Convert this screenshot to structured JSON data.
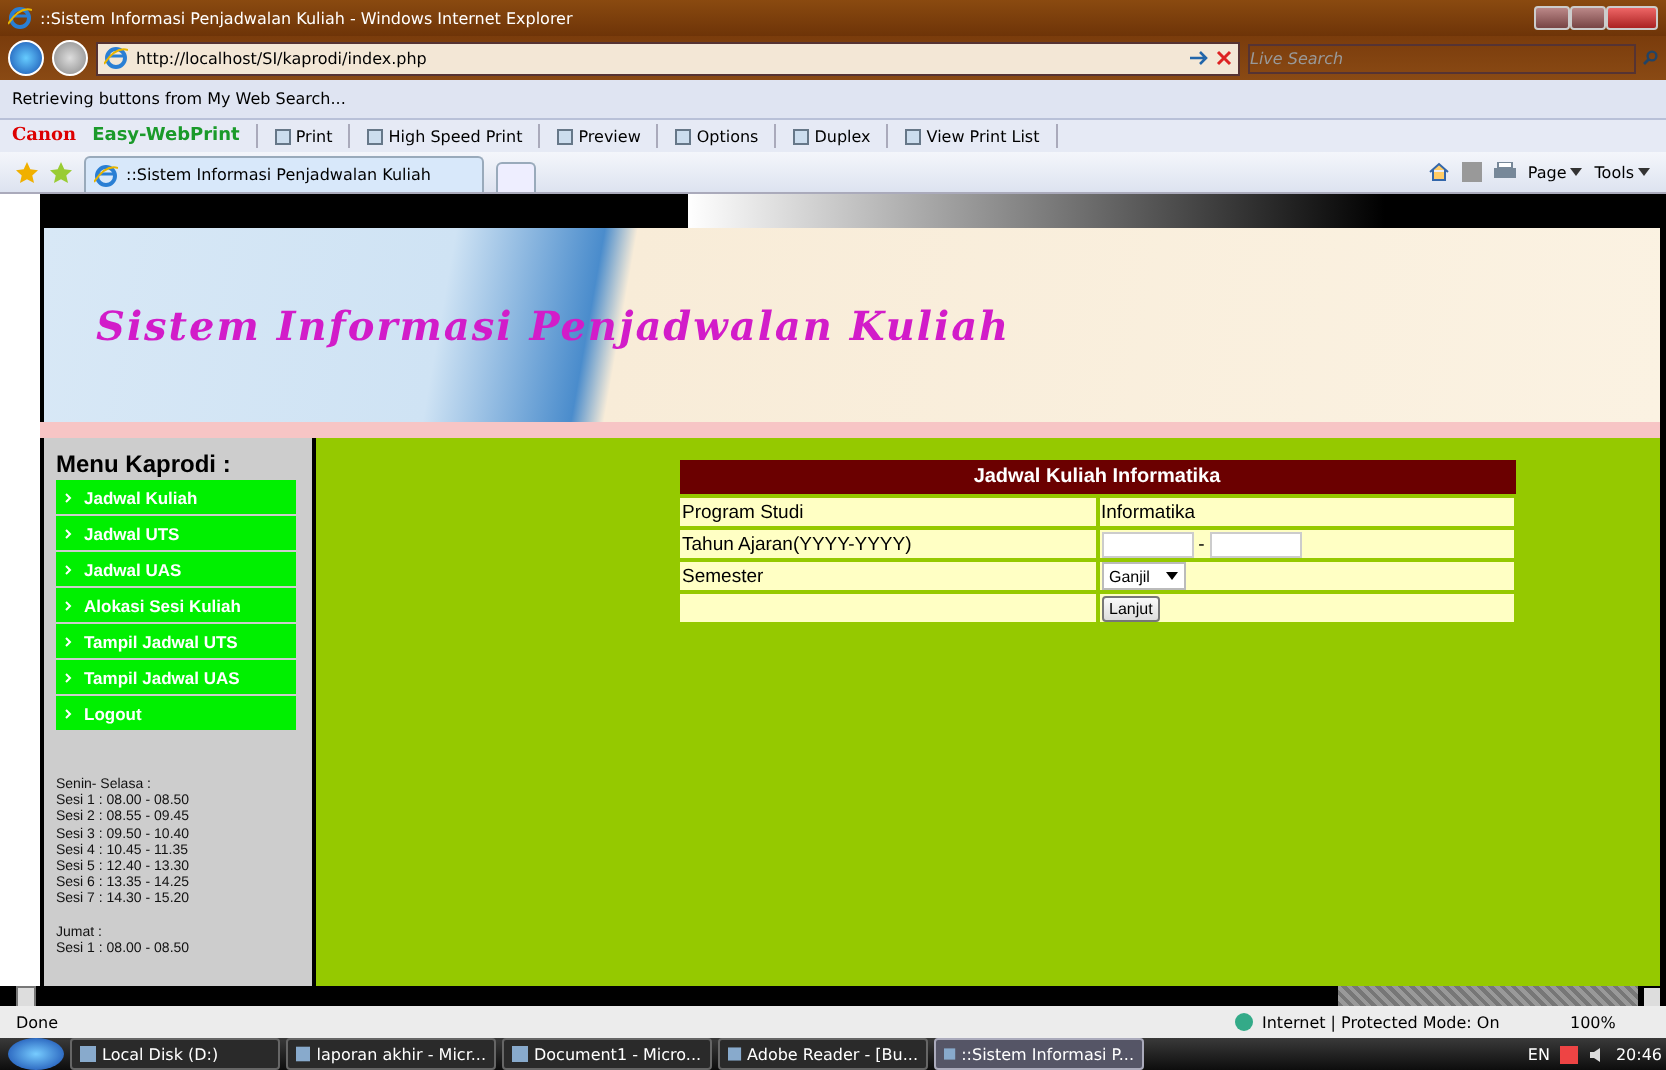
{
  "window": {
    "title": "::Sistem Informasi Penjadwalan Kuliah - Windows Internet Explorer"
  },
  "address_bar": {
    "url": "http://localhost/SI/kaprodi/index.php"
  },
  "search": {
    "placeholder": "Live Search"
  },
  "info_bar": {
    "text": "Retrieving buttons from My Web Search..."
  },
  "print_toolbar": {
    "brand": "Canon",
    "product": "Easy-WebPrint",
    "buttons": [
      "Print",
      "High Speed Print",
      "Preview",
      "Options",
      "Duplex",
      "View Print List"
    ]
  },
  "tabs": [
    {
      "label": "::Sistem Informasi Penjadwalan Kuliah",
      "selected": true
    }
  ],
  "command_bar": [
    "Page",
    "Tools"
  ],
  "page": {
    "site_title": "Sistem Informasi Penjadwalan Kuliah",
    "menu": {
      "title": "Menu Kaprodi :",
      "items": [
        "Jadwal Kuliah",
        "Jadwal UTS",
        "Jadwal UAS",
        "Alokasi Sesi Kuliah",
        "Tampil Jadwal UTS",
        "Tampil Jadwal UAS",
        "Logout"
      ]
    },
    "schedule": [
      {
        "heading": "Senin- Selasa :",
        "lines": [
          "Sesi 1 : 08.00 - 08.50",
          "Sesi 2 : 08.55 - 09.45",
          "Sesi 3 : 09.50 - 10.40",
          "Sesi 4 : 10.45 - 11.35",
          "Sesi 5 : 12.40 - 13.30",
          "Sesi 6 : 13.35 - 14.25",
          "Sesi 7 : 14.30 - 15.20"
        ]
      },
      {
        "heading": "Jumat :",
        "lines": [
          "Sesi 1 : 08.00 - 08.50"
        ]
      }
    ],
    "form": {
      "title": "Jadwal Kuliah Informatika",
      "rows": [
        {
          "kind": "text",
          "label": "Program Studi",
          "value": "Informatika"
        },
        {
          "kind": "range",
          "label": "Tahun Ajaran(YYYY-YYYY)",
          "separator": "-"
        },
        {
          "kind": "select",
          "label": "Semester",
          "value": "Ganjil"
        },
        {
          "kind": "button",
          "value": "Lanjut"
        }
      ]
    }
  },
  "status_bar": {
    "status": "Done",
    "zone": "Internet | Protected Mode: On",
    "zoom": "100%"
  },
  "taskbar": {
    "items": [
      {
        "label": "Local Disk (D:)",
        "selected": false
      },
      {
        "label": "laporan akhir - Micr...",
        "selected": false
      },
      {
        "label": "Document1 - Micro...",
        "selected": false
      },
      {
        "label": "Adobe Reader - [Bu...",
        "selected": false
      },
      {
        "label": "::Sistem Informasi P...",
        "selected": true
      }
    ],
    "language": "EN",
    "clock": "20:46"
  }
}
